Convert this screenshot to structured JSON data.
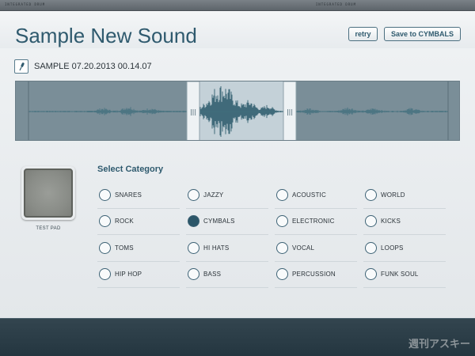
{
  "topbar": {
    "left_text": "INTEGRATED DRUM",
    "right_text": "INTEGRATED DRUM"
  },
  "header": {
    "title": "Sample New Sound",
    "retry_label": "retry",
    "save_label": "Save to CYMBALS"
  },
  "sample": {
    "icon": "microphone-icon",
    "name": "SAMPLE 07.20.2013 00.14.07"
  },
  "waveform": {
    "handle_glyph": "|||",
    "colors": {
      "background": "#7a8e98",
      "selection": "#c4d1d8",
      "wave": "#44717f",
      "wave_selected": "#1f5063"
    }
  },
  "test_pad": {
    "label": "TEST PAD"
  },
  "category": {
    "heading": "Select Category",
    "selected": "CYMBALS",
    "options": [
      {
        "label": "SNARES",
        "selected": false
      },
      {
        "label": "JAZZY",
        "selected": false
      },
      {
        "label": "ACOUSTIC",
        "selected": false
      },
      {
        "label": "WORLD",
        "selected": false
      },
      {
        "label": "ROCK",
        "selected": false
      },
      {
        "label": "CYMBALS",
        "selected": true
      },
      {
        "label": "ELECTRONIC",
        "selected": false
      },
      {
        "label": "KICKS",
        "selected": false
      },
      {
        "label": "TOMS",
        "selected": false
      },
      {
        "label": "HI HATS",
        "selected": false
      },
      {
        "label": "VOCAL",
        "selected": false
      },
      {
        "label": "LOOPS",
        "selected": false
      },
      {
        "label": "HIP HOP",
        "selected": false
      },
      {
        "label": "BASS",
        "selected": false
      },
      {
        "label": "PERCUSSION",
        "selected": false
      },
      {
        "label": "FUNK SOUL",
        "selected": false
      }
    ]
  },
  "watermark": "週刊アスキー",
  "accent_color": "#2f5a6e"
}
